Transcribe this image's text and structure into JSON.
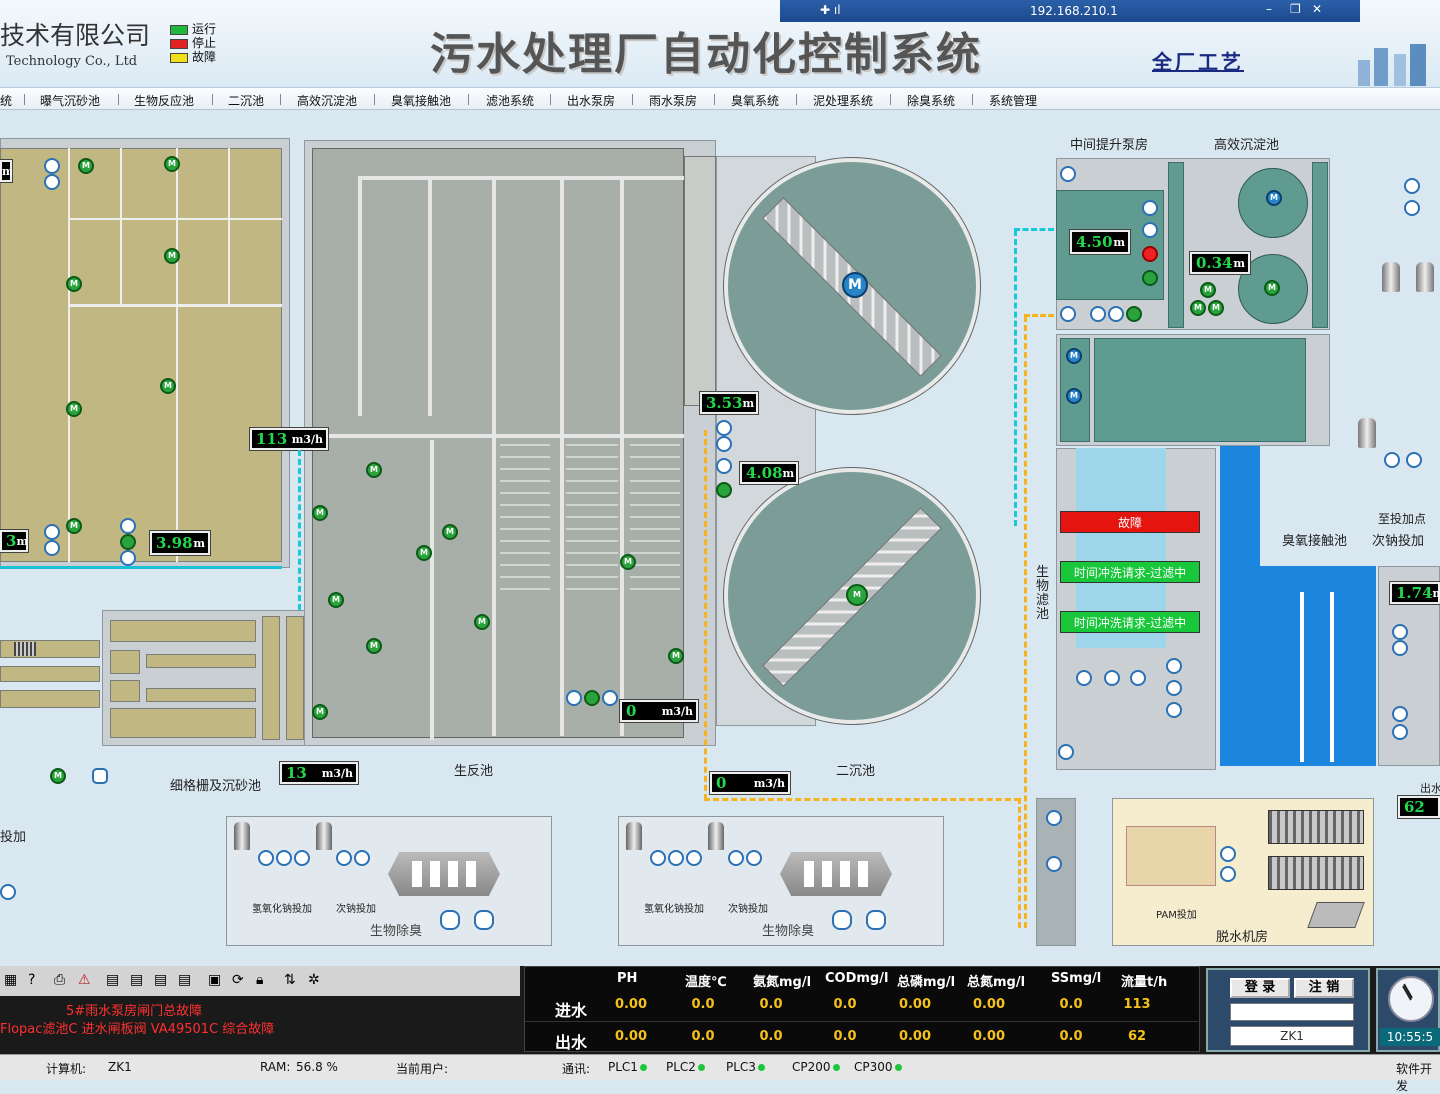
{
  "company": {
    "name": "技术有限公司",
    "name_en": "Technology Co., Ltd"
  },
  "legend": [
    {
      "label": "运行",
      "color": "#1fb83a"
    },
    {
      "label": "停止",
      "color": "#e22222"
    },
    {
      "label": "故障",
      "color": "#f0e01a"
    }
  ],
  "remote": {
    "ip": "192.168.210.1"
  },
  "title": "污水处理厂自动化控制系统",
  "overview_link": "全厂工艺",
  "menu": [
    "统",
    "曝气沉砂池",
    "生物反应池",
    "二沉池",
    "高效沉淀池",
    "臭氧接触池",
    "滤池系统",
    "出水泵房",
    "雨水泵房",
    "臭氧系统",
    "泥处理系统",
    "除臭系统",
    "系统管理"
  ],
  "labels": {
    "grit": "细格栅及沉砂池",
    "bioreactor": "生反池",
    "secondary": "二沉池",
    "lift_pump": "中间提升泵房",
    "hd_clarifier": "高效沉淀池",
    "ozone": "臭氧接触池",
    "biofilter": "生物滤池",
    "dosing_point": "至投加点",
    "hypo_dosing": "次钠投加",
    "deodor": "生物除臭",
    "naoh": "氢氧化钠投加",
    "hypo": "次钠投加",
    "pam": "PAM投加",
    "dewater": "脱水机房",
    "left_dosing": "投加",
    "outlet": "出水"
  },
  "lcd": {
    "inflow": {
      "value": "113",
      "unit": "m3/h"
    },
    "left_level": {
      "value": "3.98",
      "unit": "m"
    },
    "left_cut": {
      "value": "3",
      "unit": "m"
    },
    "left_top": {
      "value": "",
      "unit": "m"
    },
    "grit_flow": {
      "value": "13",
      "unit": "m3/h"
    },
    "bio_out": {
      "value": "0",
      "unit": "m3/h"
    },
    "sludge_flow": {
      "value": "0",
      "unit": "m3/h"
    },
    "sec_level1": {
      "value": "3.53",
      "unit": "m"
    },
    "sec_level2": {
      "value": "4.08",
      "unit": "m"
    },
    "lift_level": {
      "value": "4.50",
      "unit": "m"
    },
    "hd_level": {
      "value": "0.34",
      "unit": "m"
    },
    "right_level": {
      "value": "1.74",
      "unit": "m"
    },
    "right_flow": {
      "value": "62",
      "unit": ""
    }
  },
  "motor_letter": "M",
  "filter_status": [
    {
      "text": "故障",
      "color": "#e5140f"
    },
    {
      "text": "时间冲洗请求-过滤中",
      "color": "#18c73a"
    },
    {
      "text": "时间冲洗请求-过滤中",
      "color": "#18c73a"
    }
  ],
  "alarms": [
    "5#雨水泵房闸门总故障",
    "Flopac滤池C 进水闸板阀 VA49501C 综合故障"
  ],
  "quality": {
    "headers": [
      "PH",
      "温度℃",
      "氨氮mg/l",
      "CODmg/l",
      "总磷mg/l",
      "总氮mg/l",
      "SSmg/l",
      "流量t/h"
    ],
    "inlet_label": "进水",
    "outlet_label": "出水",
    "inlet": [
      "0.00",
      "0.0",
      "0.0",
      "0.0",
      "0.00",
      "0.00",
      "0.0",
      "113"
    ],
    "outlet": [
      "0.00",
      "0.0",
      "0.0",
      "0.0",
      "0.00",
      "0.00",
      "0.0",
      "62"
    ]
  },
  "login": {
    "login_btn": "登 录",
    "logout_btn": "注 销",
    "user": "ZK1"
  },
  "clock": "10:55:5",
  "footer": {
    "computer_label": "计算机:",
    "computer": "ZK1",
    "ram_label": "RAM:",
    "ram": "56.8 %",
    "user_label": "当前用户:",
    "user": "",
    "comm_label": "通讯:",
    "plcs": [
      "PLC1",
      "PLC2",
      "PLC3",
      "CP200",
      "CP300"
    ],
    "right": "软件开发"
  }
}
